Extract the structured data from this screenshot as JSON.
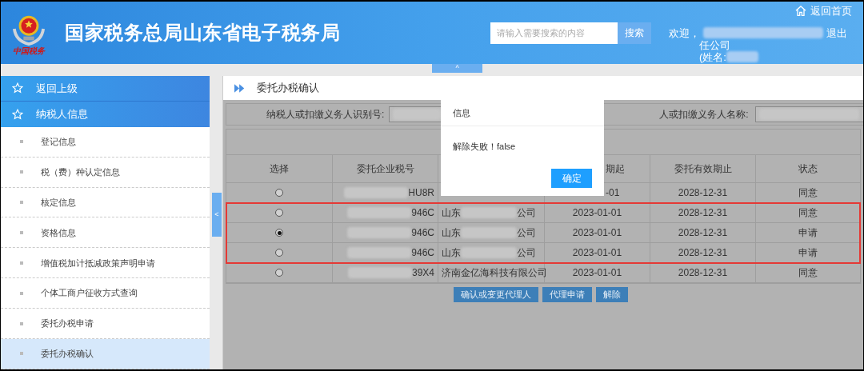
{
  "header": {
    "title": "国家税务总局山东省电子税务局",
    "logo_caption": "中国税务",
    "search": {
      "placeholder": "请输入需要搜索的内容",
      "button": "搜索"
    },
    "welcome": "欢迎，",
    "company_tail": "任公司",
    "name_label": "(姓名:",
    "home_link": "返回首页",
    "logout": "退出",
    "collapse_tab": "^"
  },
  "sidebar": {
    "back": "返回上级",
    "section": "纳税人信息",
    "collapse_handle": "<",
    "items": [
      {
        "label": "登记信息",
        "selected": false
      },
      {
        "label": "税（费）种认定信息",
        "selected": false
      },
      {
        "label": "核定信息",
        "selected": false
      },
      {
        "label": "资格信息",
        "selected": false
      },
      {
        "label": "增值税加计抵减政策声明申请",
        "selected": false
      },
      {
        "label": "个体工商户征收方式查询",
        "selected": false
      },
      {
        "label": "委托办税申请",
        "selected": false
      },
      {
        "label": "委托办税确认",
        "selected": true
      }
    ]
  },
  "page": {
    "title": "委托办税确认",
    "form": {
      "id_label": "纳税人或扣缴义务人识别号:",
      "name_label": "人或扣缴义务人名称:"
    },
    "table": {
      "columns": [
        {
          "label": "选择",
          "kind": "full"
        },
        {
          "label": "委托企业税号",
          "kind": "full"
        },
        {
          "label": "期起",
          "kind": "clipped"
        },
        {
          "label": "委托有效期止",
          "kind": "full"
        },
        {
          "label": "状态",
          "kind": "full"
        }
      ],
      "rows": [
        {
          "selected": false,
          "highlighted": false,
          "tax_id_tail": "HU8R",
          "start": "-01",
          "start_clipped": true,
          "end": "2028-12-31",
          "status": "同意"
        },
        {
          "selected": false,
          "highlighted": true,
          "tax_id_tail": "946C",
          "company": "山东",
          "company_tail": "公司",
          "start": "2023-01-01",
          "start_clipped": false,
          "end": "2028-12-31",
          "status": "同意"
        },
        {
          "selected": true,
          "highlighted": true,
          "tax_id_tail": "946C",
          "company": "山东",
          "company_tail": "公司",
          "start": "2023-01-01",
          "start_clipped": false,
          "end": "2028-12-31",
          "status": "申请"
        },
        {
          "selected": false,
          "highlighted": true,
          "tax_id_tail": "946C",
          "company": "山东",
          "company_tail": "公司",
          "start": "2023-01-01",
          "start_clipped": false,
          "end": "2028-12-31",
          "status": "申请"
        },
        {
          "selected": false,
          "highlighted": false,
          "tax_id_tail": "39X4",
          "company": "济南金亿海科技有限公司",
          "start": "2023-01-01",
          "start_clipped": false,
          "end": "2028-12-31",
          "status": "同意"
        }
      ]
    },
    "buttons": [
      "确认或变更代理人",
      "代理申请",
      "解除"
    ],
    "dialog": {
      "title": "信息",
      "message": "解除失败！false",
      "button": "确定"
    }
  }
}
